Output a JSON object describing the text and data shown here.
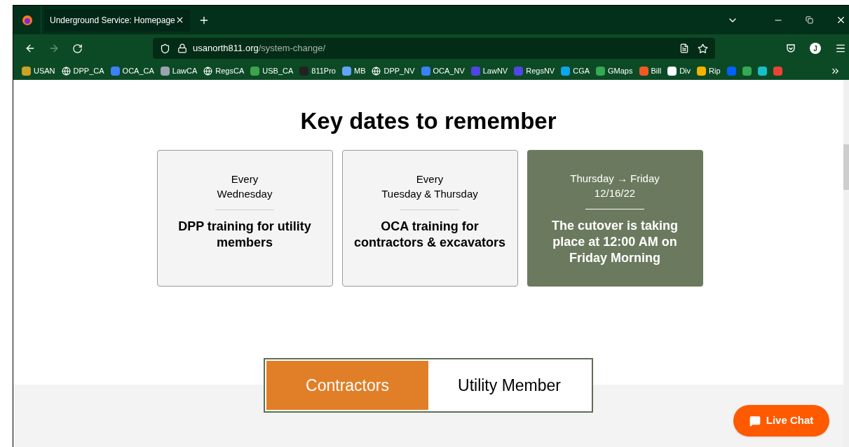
{
  "browser": {
    "tab_title": "Underground Service: Homepage",
    "url_host": "usanorth811.org",
    "url_path": "/system-change/",
    "bookmarks": [
      "USAN",
      "DPP_CA",
      "OCA_CA",
      "LawCA",
      "RegsCA",
      "USB_CA",
      "811Pro",
      "MB",
      "DPP_NV",
      "OCA_NV",
      "LawNV",
      "RegsNV",
      "CGA",
      "GMaps",
      "Bill",
      "Div",
      "Rip"
    ],
    "profile_initial": "J"
  },
  "page": {
    "heading": "Key dates to remember",
    "cards": [
      {
        "when": [
          "Every",
          "Wednesday"
        ],
        "title": "DPP training for utility members",
        "highlighted": false
      },
      {
        "when": [
          "Every",
          "Tuesday & Thursday"
        ],
        "title": "OCA training for contractors & excavators",
        "highlighted": false
      },
      {
        "when": [
          "Thursday → Friday",
          "12/16/22"
        ],
        "title": "The cutover is taking place at 12:00 AM on Friday Morning",
        "highlighted": true
      }
    ],
    "audience_tabs": [
      {
        "label": "Contractors",
        "selected": true
      },
      {
        "label": "Utility Member",
        "selected": false
      }
    ],
    "chat_button": "Live Chat"
  }
}
